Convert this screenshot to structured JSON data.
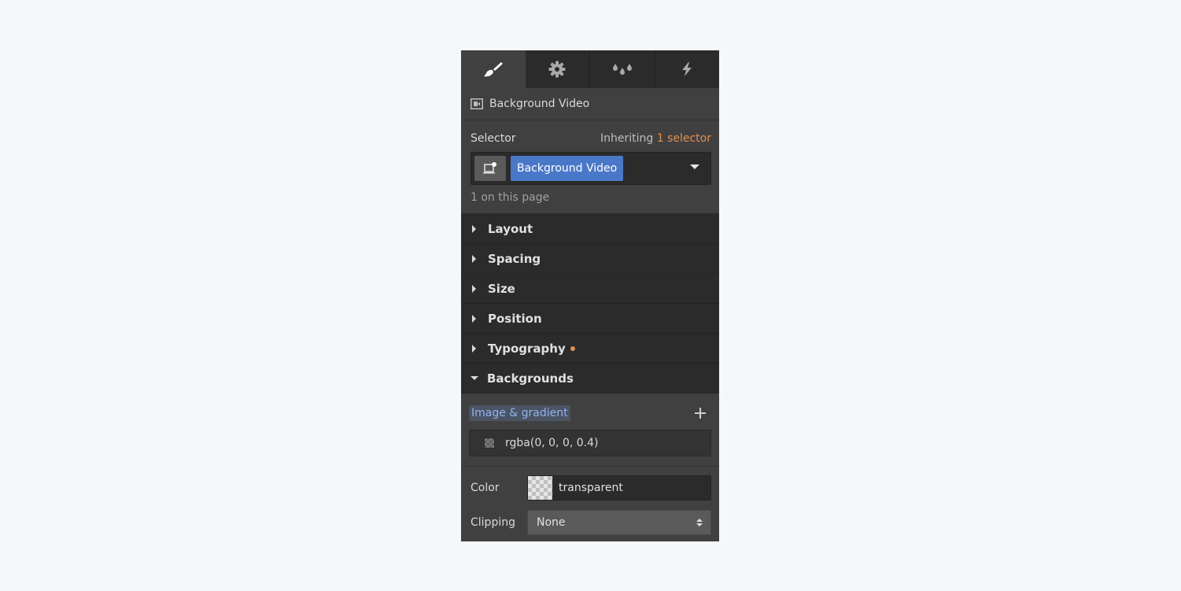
{
  "tabs": [
    {
      "name": "style",
      "icon": "paintbrush-icon",
      "active": true
    },
    {
      "name": "settings",
      "icon": "gear-icon",
      "active": false
    },
    {
      "name": "style-manager",
      "icon": "droplets-icon",
      "active": false
    },
    {
      "name": "interactions",
      "icon": "lightning-icon",
      "active": false
    }
  ],
  "element": {
    "icon": "video-icon",
    "label": "Background Video"
  },
  "selector": {
    "label": "Selector",
    "inheriting_prefix": "Inheriting",
    "inheriting_link": "1 selector",
    "pill": "Background Video",
    "count": "1 on this page",
    "accent_color": "#e0904f",
    "pill_color": "#4a78c9"
  },
  "sections": [
    {
      "label": "Layout",
      "expanded": false,
      "modified": false
    },
    {
      "label": "Spacing",
      "expanded": false,
      "modified": false
    },
    {
      "label": "Size",
      "expanded": false,
      "modified": false
    },
    {
      "label": "Position",
      "expanded": false,
      "modified": false
    },
    {
      "label": "Typography",
      "expanded": false,
      "modified": true
    },
    {
      "label": "Backgrounds",
      "expanded": true,
      "modified": false
    }
  ],
  "backgrounds": {
    "image_gradient_label": "Image & gradient",
    "layers": [
      {
        "value": "rgba(0, 0, 0, 0.4)"
      }
    ],
    "color_label": "Color",
    "color_value": "transparent",
    "clipping_label": "Clipping",
    "clipping_value": "None"
  }
}
